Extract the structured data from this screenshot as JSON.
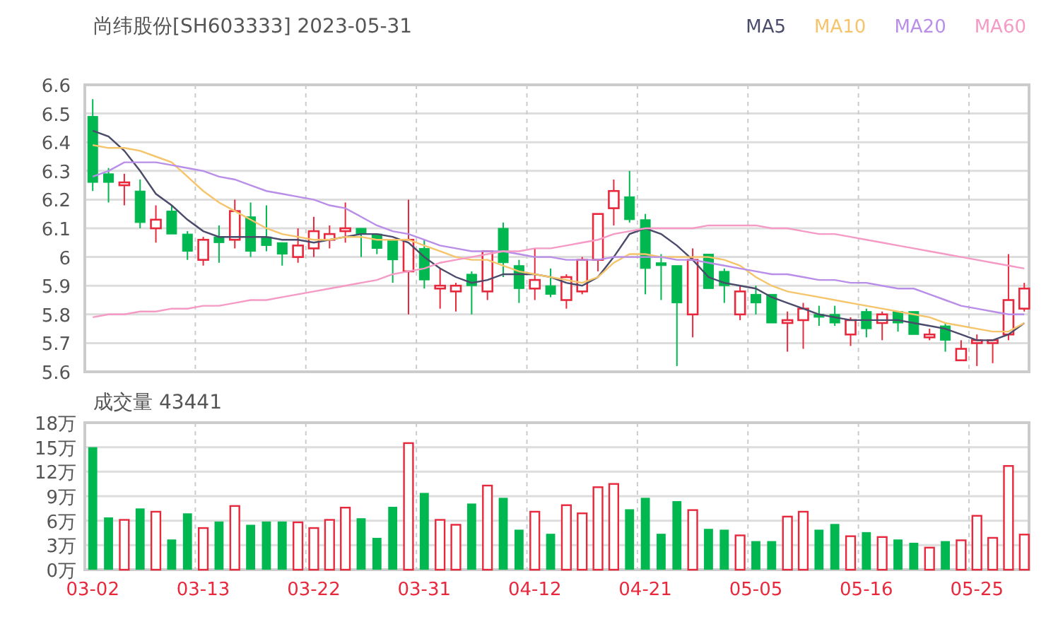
{
  "title": "尚纬股份[SH603333] 2023-05-31",
  "price_chart": {
    "chart_data": {
      "type": "candlestick",
      "grid": true,
      "ylim": [
        5.6,
        6.6
      ],
      "yticks": [
        5.6,
        5.7,
        5.8,
        5.9,
        6,
        6.1,
        6.2,
        6.3,
        6.4,
        6.5,
        6.6
      ],
      "ohlc": [
        [
          6.49,
          6.55,
          6.23,
          6.26
        ],
        [
          6.29,
          6.31,
          6.19,
          6.26
        ],
        [
          6.25,
          6.29,
          6.18,
          6.26
        ],
        [
          6.23,
          6.27,
          6.1,
          6.12
        ],
        [
          6.1,
          6.18,
          6.05,
          6.13
        ],
        [
          6.16,
          6.18,
          6.08,
          6.08
        ],
        [
          6.08,
          6.09,
          5.99,
          6.02
        ],
        [
          5.99,
          6.07,
          5.97,
          6.06
        ],
        [
          6.07,
          6.11,
          5.98,
          6.05
        ],
        [
          6.06,
          6.2,
          6.03,
          6.16
        ],
        [
          6.14,
          6.19,
          6.0,
          6.02
        ],
        [
          6.07,
          6.18,
          6.02,
          6.04
        ],
        [
          6.05,
          6.05,
          5.97,
          6.01
        ],
        [
          6.0,
          6.1,
          5.98,
          6.04
        ],
        [
          6.03,
          6.14,
          6.0,
          6.09
        ],
        [
          6.06,
          6.11,
          6.03,
          6.08
        ],
        [
          6.09,
          6.19,
          6.05,
          6.1
        ],
        [
          6.1,
          6.1,
          6.0,
          6.08
        ],
        [
          6.08,
          6.08,
          6.01,
          6.03
        ],
        [
          6.06,
          6.06,
          5.91,
          5.99
        ],
        [
          5.95,
          6.2,
          5.8,
          6.06
        ],
        [
          6.03,
          6.06,
          5.89,
          5.92
        ],
        [
          5.89,
          5.96,
          5.82,
          5.9
        ],
        [
          5.88,
          5.91,
          5.81,
          5.9
        ],
        [
          5.94,
          5.95,
          5.8,
          5.9
        ],
        [
          5.88,
          6.02,
          5.85,
          6.02
        ],
        [
          6.1,
          6.12,
          5.93,
          5.98
        ],
        [
          5.97,
          5.99,
          5.84,
          5.89
        ],
        [
          5.89,
          6.03,
          5.85,
          5.92
        ],
        [
          5.9,
          5.96,
          5.86,
          5.87
        ],
        [
          5.85,
          5.94,
          5.82,
          5.93
        ],
        [
          5.88,
          6.0,
          5.87,
          5.99
        ],
        [
          5.99,
          6.15,
          5.95,
          6.15
        ],
        [
          6.17,
          6.27,
          6.11,
          6.23
        ],
        [
          6.21,
          6.3,
          6.12,
          6.13
        ],
        [
          6.13,
          6.15,
          5.87,
          5.96
        ],
        [
          5.98,
          6.01,
          5.85,
          5.97
        ],
        [
          5.97,
          5.97,
          5.62,
          5.84
        ],
        [
          5.8,
          6.03,
          5.72,
          5.99
        ],
        [
          6.01,
          6.01,
          5.89,
          5.89
        ],
        [
          5.95,
          5.96,
          5.84,
          5.9
        ],
        [
          5.8,
          5.9,
          5.78,
          5.88
        ],
        [
          5.87,
          5.9,
          5.8,
          5.84
        ],
        [
          5.87,
          5.87,
          5.77,
          5.77
        ],
        [
          5.77,
          5.81,
          5.67,
          5.78
        ],
        [
          5.78,
          5.84,
          5.68,
          5.82
        ],
        [
          5.8,
          5.83,
          5.76,
          5.79
        ],
        [
          5.8,
          5.83,
          5.76,
          5.77
        ],
        [
          5.73,
          5.79,
          5.69,
          5.78
        ],
        [
          5.81,
          5.82,
          5.72,
          5.75
        ],
        [
          5.77,
          5.81,
          5.71,
          5.8
        ],
        [
          5.81,
          5.81,
          5.74,
          5.77
        ],
        [
          5.81,
          5.81,
          5.73,
          5.73
        ],
        [
          5.72,
          5.75,
          5.71,
          5.73
        ],
        [
          5.76,
          5.77,
          5.67,
          5.71
        ],
        [
          5.64,
          5.71,
          5.64,
          5.68
        ],
        [
          5.7,
          5.73,
          5.62,
          5.71
        ],
        [
          5.7,
          5.71,
          5.63,
          5.71
        ],
        [
          5.73,
          6.01,
          5.71,
          5.85
        ],
        [
          5.82,
          5.91,
          5.81,
          5.89
        ]
      ],
      "series": [
        {
          "name": "MA5",
          "type": "line",
          "color": "#4a4a6a",
          "values": [
            6.44,
            6.42,
            6.37,
            6.3,
            6.22,
            6.18,
            6.13,
            6.09,
            6.07,
            6.07,
            6.07,
            6.07,
            6.06,
            6.06,
            6.05,
            6.06,
            6.07,
            6.08,
            6.08,
            6.07,
            6.05,
            6.0,
            5.96,
            5.93,
            5.91,
            5.92,
            5.94,
            5.94,
            5.94,
            5.93,
            5.91,
            5.9,
            5.93,
            6.0,
            6.08,
            6.1,
            6.08,
            6.04,
            5.99,
            5.93,
            5.91,
            5.9,
            5.89,
            5.86,
            5.84,
            5.82,
            5.8,
            5.79,
            5.78,
            5.78,
            5.78,
            5.78,
            5.77,
            5.76,
            5.75,
            5.73,
            5.71,
            5.71,
            5.73,
            5.77
          ]
        },
        {
          "name": "MA10",
          "type": "line",
          "color": "#f5c46b",
          "values": [
            6.39,
            6.38,
            6.38,
            6.37,
            6.35,
            6.33,
            6.28,
            6.23,
            6.19,
            6.16,
            6.13,
            6.1,
            6.08,
            6.07,
            6.06,
            6.06,
            6.07,
            6.07,
            6.06,
            6.06,
            6.06,
            6.04,
            6.02,
            6.0,
            5.99,
            5.99,
            5.97,
            5.95,
            5.94,
            5.93,
            5.92,
            5.91,
            5.93,
            5.98,
            6.01,
            6.01,
            6.0,
            6.0,
            6.0,
            6.0,
            5.99,
            5.97,
            5.93,
            5.9,
            5.88,
            5.87,
            5.86,
            5.85,
            5.84,
            5.83,
            5.82,
            5.81,
            5.8,
            5.79,
            5.77,
            5.76,
            5.75,
            5.74,
            5.74,
            5.77
          ]
        },
        {
          "name": "MA20",
          "type": "line",
          "color": "#b98ee8",
          "values": [
            6.28,
            6.3,
            6.33,
            6.33,
            6.33,
            6.32,
            6.31,
            6.3,
            6.28,
            6.27,
            6.25,
            6.23,
            6.22,
            6.21,
            6.2,
            6.18,
            6.17,
            6.14,
            6.11,
            6.09,
            6.08,
            6.06,
            6.04,
            6.03,
            6.02,
            6.02,
            6.02,
            6.01,
            6.0,
            6.0,
            5.99,
            5.99,
            5.99,
            6.0,
            6.0,
            6.0,
            6.0,
            5.99,
            5.99,
            5.98,
            5.97,
            5.96,
            5.95,
            5.94,
            5.94,
            5.93,
            5.92,
            5.92,
            5.91,
            5.91,
            5.9,
            5.89,
            5.89,
            5.87,
            5.85,
            5.83,
            5.82,
            5.81,
            5.8,
            5.8
          ]
        },
        {
          "name": "MA60",
          "type": "line",
          "color": "#f59ac4",
          "values": [
            5.79,
            5.8,
            5.8,
            5.81,
            5.81,
            5.82,
            5.82,
            5.83,
            5.83,
            5.84,
            5.85,
            5.85,
            5.86,
            5.87,
            5.88,
            5.89,
            5.9,
            5.91,
            5.92,
            5.94,
            5.95,
            5.96,
            5.98,
            5.99,
            6.0,
            6.01,
            6.02,
            6.02,
            6.03,
            6.03,
            6.04,
            6.05,
            6.06,
            6.08,
            6.09,
            6.1,
            6.1,
            6.1,
            6.1,
            6.11,
            6.11,
            6.11,
            6.11,
            6.1,
            6.1,
            6.09,
            6.08,
            6.08,
            6.07,
            6.06,
            6.05,
            6.04,
            6.03,
            6.02,
            6.01,
            6.0,
            5.99,
            5.98,
            5.97,
            5.96
          ]
        }
      ]
    }
  },
  "volume_panel": {
    "title": "成交量 43441",
    "chart_data": {
      "type": "bar",
      "grid": true,
      "ylim": [
        0,
        18
      ],
      "categories": [
        "03-02",
        null,
        null,
        null,
        null,
        null,
        null,
        "03-13",
        null,
        null,
        null,
        null,
        null,
        null,
        "03-22",
        null,
        null,
        null,
        null,
        null,
        null,
        "03-31",
        null,
        null,
        null,
        null,
        null,
        null,
        "04-12",
        null,
        null,
        null,
        null,
        null,
        null,
        "04-21",
        null,
        null,
        null,
        null,
        null,
        null,
        "05-05",
        null,
        null,
        null,
        null,
        null,
        null,
        "05-16",
        null,
        null,
        null,
        null,
        null,
        null,
        "05-25",
        null,
        null,
        null
      ],
      "yticks": [
        {
          "value": 0,
          "label": "0万"
        },
        {
          "value": 3,
          "label": "3万"
        },
        {
          "value": 6,
          "label": "6万"
        },
        {
          "value": 9,
          "label": "9万"
        },
        {
          "value": 12,
          "label": "12万"
        },
        {
          "value": 15,
          "label": "15万"
        },
        {
          "value": 18,
          "label": "18万"
        }
      ],
      "values": [
        15.0,
        6.4,
        6.1,
        7.5,
        7.1,
        3.7,
        6.9,
        5.1,
        5.9,
        7.8,
        5.5,
        5.9,
        5.9,
        5.8,
        5.1,
        6.1,
        7.6,
        6.3,
        3.9,
        7.7,
        15.5,
        9.4,
        6.1,
        5.5,
        8.1,
        10.3,
        8.8,
        4.9,
        7.1,
        4.4,
        7.9,
        6.9,
        10.1,
        10.5,
        7.4,
        8.8,
        4.4,
        8.4,
        7.3,
        5.0,
        4.9,
        4.2,
        3.5,
        3.5,
        6.5,
        7.1,
        4.9,
        5.6,
        4.1,
        4.6,
        4.0,
        3.7,
        3.3,
        2.7,
        3.5,
        3.6,
        6.6,
        3.9,
        12.7,
        4.3
      ]
    }
  }
}
